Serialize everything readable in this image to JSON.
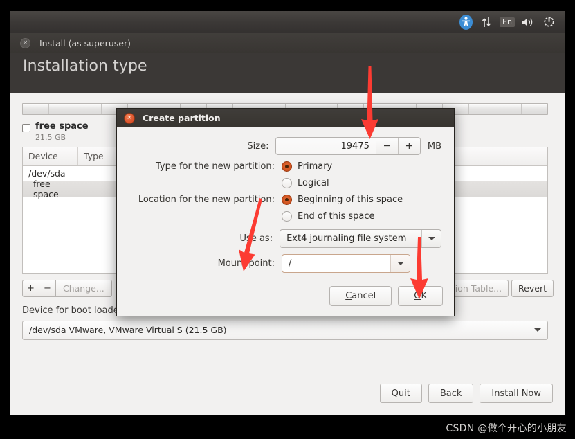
{
  "top_panel": {
    "icons": [
      {
        "name": "accessibility-icon",
        "glyph": "person"
      },
      {
        "name": "network-icon",
        "glyph": "↑↓"
      },
      {
        "name": "keyboard-layout-indicator",
        "glyph": "En"
      },
      {
        "name": "volume-icon",
        "glyph": "🔊"
      },
      {
        "name": "system-power-icon",
        "glyph": "⚙"
      }
    ]
  },
  "installer_window": {
    "titlebar_title": "Install (as superuser)",
    "close_glyph": "×",
    "page_title": "Installation type",
    "free_space": {
      "label": "free space",
      "size": "21.5 GB"
    },
    "table": {
      "columns": [
        "Device",
        "Type",
        ""
      ],
      "rows": [
        {
          "device": "/dev/sda",
          "type": "",
          "indent": false
        },
        {
          "device": "free space",
          "type": "",
          "indent": true
        }
      ]
    },
    "toolbar": {
      "add_label": "+",
      "remove_label": "−",
      "change_label": "Change...",
      "new_partition_table_label": "ion Table...",
      "revert_label": "Revert"
    },
    "bootloader": {
      "label": "Device for boot loader installation:",
      "selected": "/dev/sda VMware, VMware Virtual S (21.5 GB)"
    },
    "actions": {
      "quit_label": "Quit",
      "back_label": "Back",
      "install_now_label": "Install Now"
    }
  },
  "dialog": {
    "title": "Create partition",
    "close_glyph": "×",
    "size": {
      "label": "Size:",
      "value": "19475",
      "unit": "MB",
      "decrement_glyph": "−",
      "increment_glyph": "+"
    },
    "type": {
      "label": "Type for the new partition:",
      "options": [
        {
          "label": "Primary",
          "checked": true
        },
        {
          "label": "Logical",
          "checked": false
        }
      ]
    },
    "location": {
      "label": "Location for the new partition:",
      "options": [
        {
          "label": "Beginning of this space",
          "checked": true
        },
        {
          "label": "End of this space",
          "checked": false
        }
      ]
    },
    "use_as": {
      "label": "Use as:",
      "selected": "Ext4 journaling file system"
    },
    "mount_point": {
      "label": "Mount point:",
      "selected": "/"
    },
    "buttons": {
      "cancel_label": "Cancel",
      "cancel_accel": "C",
      "ok_label": "OK",
      "ok_accel": "O"
    }
  },
  "annotations": {
    "arrow_color": "#fc3b32",
    "arrows": [
      {
        "name": "arrow-to-size-field"
      },
      {
        "name": "arrow-to-mount-point"
      },
      {
        "name": "arrow-to-ok-button"
      }
    ]
  },
  "watermark": {
    "text": "CSDN @做个开心的小朋友"
  }
}
